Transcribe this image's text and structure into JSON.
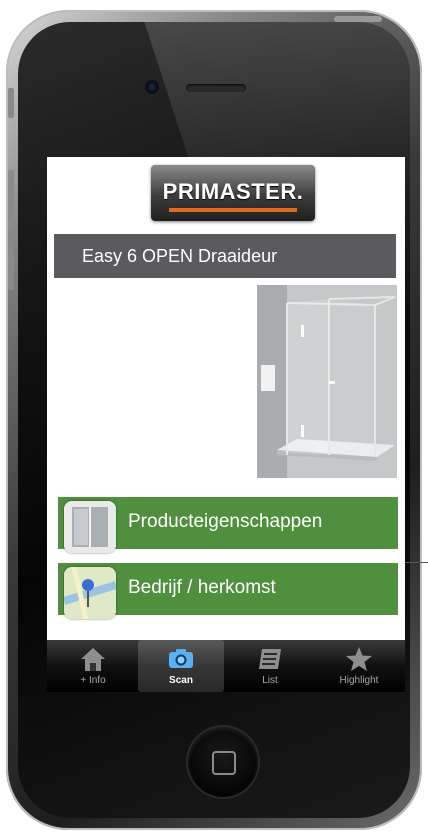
{
  "brand": {
    "logo_text": "PRIMASTER.",
    "accent_color": "#e16b1d"
  },
  "product": {
    "title": "Easy 6 OPEN Draaideur",
    "image": "shower-enclosure-photo"
  },
  "menu": [
    {
      "label": "Producteigenschappen",
      "icon": "shower-thumbnail-icon"
    },
    {
      "label": "Bedrijf / herkomst",
      "icon": "map-pin-icon"
    }
  ],
  "tabs": [
    {
      "label": "+ Info",
      "icon": "home-icon",
      "active": false
    },
    {
      "label": "Scan",
      "icon": "camera-icon",
      "active": true
    },
    {
      "label": "List",
      "icon": "list-icon",
      "active": false
    },
    {
      "label": "Highlight",
      "icon": "star-icon",
      "active": false
    }
  ],
  "colors": {
    "menu_green": "#4f8f3e",
    "title_bar": "#5b5b5f",
    "tab_active_icon": "#5ab0f0"
  }
}
